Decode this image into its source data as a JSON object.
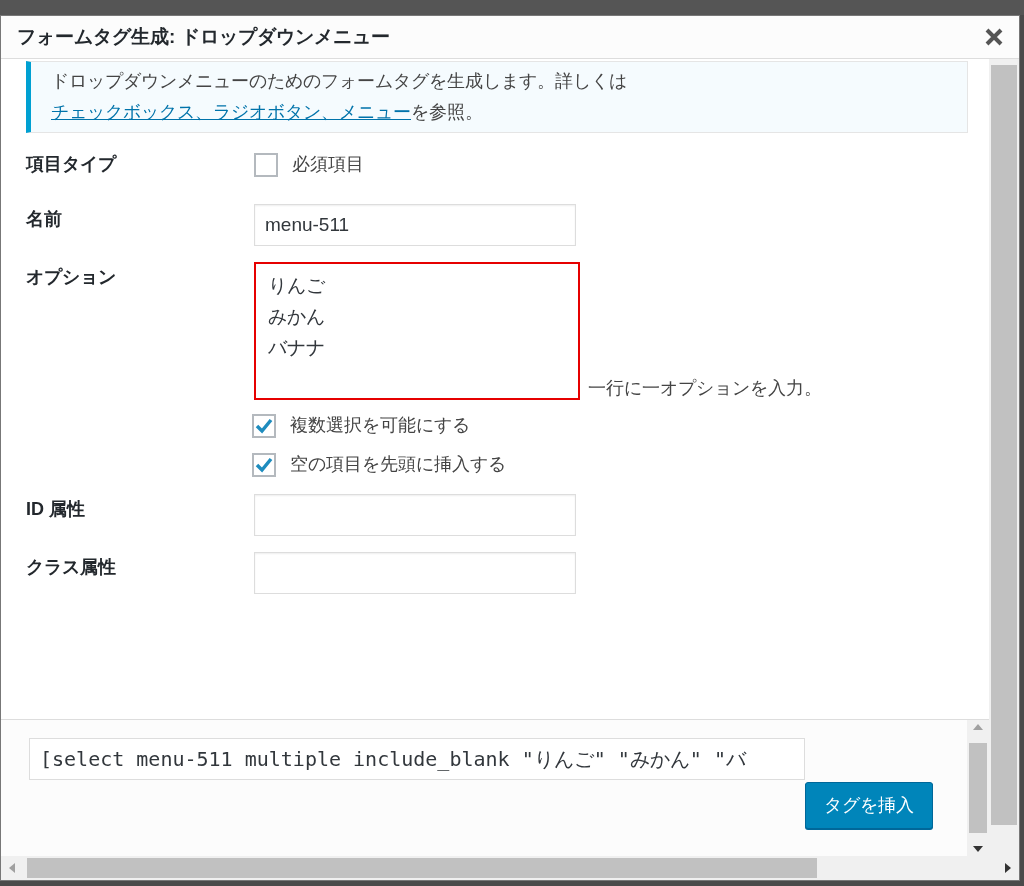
{
  "dialog": {
    "title": "フォームタグ生成: ドロップダウンメニュー"
  },
  "notice": {
    "text": "ドロップダウンメニューのためのフォームタグを生成します。詳しくは",
    "link": "チェックボックス、ラジオボタン、メニュー",
    "suffix": "を参照。"
  },
  "fields": [
    {
      "kind": "checkbox",
      "label": "項目タイプ",
      "option": "必須項目",
      "checked": false
    },
    {
      "kind": "text",
      "label": "名前",
      "value": "menu-511"
    },
    {
      "kind": "textarea",
      "label": "オプション",
      "lines": [
        "りんご",
        "みかん",
        "バナナ"
      ],
      "highlighted": true,
      "hint": "一行に一オプションを入力。",
      "options": [
        {
          "label": "複数選択を可能にする",
          "checked": true
        },
        {
          "label": "空の項目を先頭に挿入する",
          "checked": true
        }
      ]
    },
    {
      "kind": "text",
      "label": "ID 属性"
    },
    {
      "kind": "text",
      "label": "クラス属性"
    }
  ],
  "footer": {
    "tag": "[select menu-511 multiple include_blank \"りんご\" \"みかん\" \"バ",
    "button": "タグを挿入"
  }
}
